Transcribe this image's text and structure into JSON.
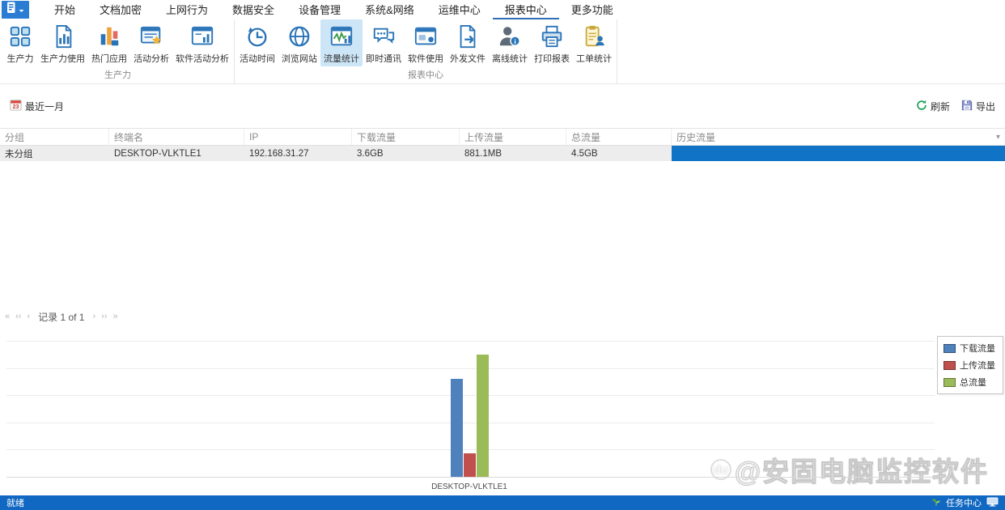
{
  "app": {
    "menu_tabs": [
      {
        "id": "start",
        "label": "开始"
      },
      {
        "id": "doc-encryption",
        "label": "文档加密"
      },
      {
        "id": "web-behavior",
        "label": "上网行为"
      },
      {
        "id": "data-security",
        "label": "数据安全"
      },
      {
        "id": "device-mgmt",
        "label": "设备管理"
      },
      {
        "id": "system-network",
        "label": "系统&网络"
      },
      {
        "id": "ops-center",
        "label": "运维中心"
      },
      {
        "id": "report-center",
        "label": "报表中心"
      },
      {
        "id": "more-features",
        "label": "更多功能"
      }
    ],
    "active_tab": "报表中心"
  },
  "ribbon": {
    "groups": [
      {
        "label": "生产力",
        "buttons": [
          {
            "id": "productivity",
            "label": "生产力",
            "icon": "grid-icon"
          },
          {
            "id": "productivity-usage",
            "label": "生产力使用",
            "icon": "doc-chart-icon"
          },
          {
            "id": "hot-apps",
            "label": "热门应用",
            "icon": "hot-apps-icon"
          },
          {
            "id": "activity-analysis",
            "label": "活动分析",
            "icon": "activity-analysis-icon"
          },
          {
            "id": "software-activity-analysis",
            "label": "软件活动分析",
            "icon": "software-activity-icon"
          }
        ]
      },
      {
        "label": "报表中心",
        "buttons": [
          {
            "id": "activity-time",
            "label": "活动时间",
            "icon": "time-history-icon"
          },
          {
            "id": "browse-websites",
            "label": "浏览网站",
            "icon": "globe-icon"
          },
          {
            "id": "traffic-stats",
            "label": "流量统计",
            "icon": "traffic-stats-icon"
          },
          {
            "id": "instant-messaging",
            "label": "即时通讯",
            "icon": "chat-icon"
          },
          {
            "id": "software-usage",
            "label": "软件使用",
            "icon": "software-usage-icon"
          },
          {
            "id": "outgoing-files",
            "label": "外发文件",
            "icon": "outgoing-file-icon"
          },
          {
            "id": "offline-stats",
            "label": "离线统计",
            "icon": "offline-stats-icon"
          },
          {
            "id": "print-report",
            "label": "打印报表",
            "icon": "print-report-icon"
          },
          {
            "id": "ticket-stats",
            "label": "工单统计",
            "icon": "ticket-stats-icon"
          }
        ]
      }
    ],
    "active_button": "流量统计"
  },
  "toolbar": {
    "date_range_label": "最近一月",
    "calendar_day": "23",
    "refresh_label": "刷新",
    "export_label": "导出"
  },
  "table": {
    "columns": [
      "分组",
      "终端名",
      "IP",
      "下载流量",
      "上传流量",
      "总流量",
      "历史流量"
    ],
    "rows": [
      {
        "group": "未分组",
        "terminal": "DESKTOP-VLKTLE1",
        "ip": "192.168.31.27",
        "download": "3.6GB",
        "upload": "881.1MB",
        "total": "4.5GB",
        "history_bar_percent": 100
      }
    ]
  },
  "pagination": {
    "label": "记录 1 of 1"
  },
  "chart_data": {
    "type": "bar",
    "categories": [
      "DESKTOP-VLKTLE1"
    ],
    "series": [
      {
        "name": "下载流量",
        "values_gb": [
          3.6
        ],
        "values_label": [
          "3.6GB"
        ],
        "color": "#4f81bd"
      },
      {
        "name": "上传流量",
        "values_gb": [
          0.86
        ],
        "values_label": [
          "881.1MB"
        ],
        "color": "#c0504d"
      },
      {
        "name": "总流量",
        "values_gb": [
          4.5
        ],
        "values_label": [
          "4.5GB"
        ],
        "color": "#9bbb59"
      }
    ],
    "ylim_gb": [
      0,
      5
    ],
    "gridlines_gb": [
      1,
      2,
      3,
      4,
      5
    ],
    "grid": true,
    "legend_position": "top-right",
    "xlabel": "",
    "ylabel": ""
  },
  "status_bar": {
    "left": "就绪",
    "right": "任务中心"
  },
  "watermark": {
    "text": "@安固电脑监控软件",
    "logo": "du"
  },
  "colors": {
    "accent_blue": "#1173c6",
    "statusbar_blue": "#1168c2",
    "ribbon_icon_blue": "#2a74b8",
    "selected_button_bg": "#cde6f7",
    "refresh_green": "#1ea05a",
    "bar_download": "#4f81bd",
    "bar_upload": "#c0504d",
    "bar_total": "#9bbb59"
  }
}
